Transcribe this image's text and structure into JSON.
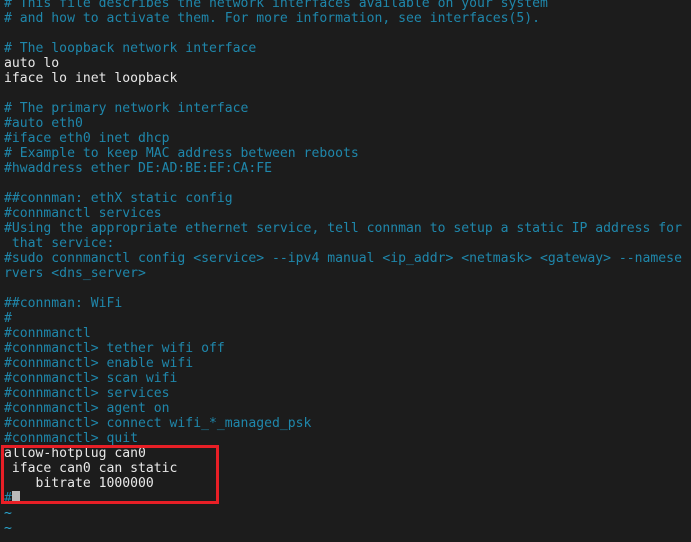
{
  "editor": {
    "background_color": "#1c1c1c",
    "comment_color": "#1f87ab",
    "text_color": "#e8e8e8",
    "tilde_color": "#2aa9d4",
    "annotation_color": "#e81f26",
    "cursor_color": "#b9b9b9"
  },
  "lines": [
    {
      "kind": "comment",
      "text": "# This file describes the network interfaces available on your system"
    },
    {
      "kind": "comment",
      "text": "# and how to activate them. For more information, see interfaces(5)."
    },
    {
      "kind": "blank",
      "text": ""
    },
    {
      "kind": "comment",
      "text": "# The loopback network interface"
    },
    {
      "kind": "plain",
      "text": "auto lo"
    },
    {
      "kind": "plain",
      "text": "iface lo inet loopback"
    },
    {
      "kind": "blank",
      "text": ""
    },
    {
      "kind": "comment",
      "text": "# The primary network interface"
    },
    {
      "kind": "comment",
      "text": "#auto eth0"
    },
    {
      "kind": "comment",
      "text": "#iface eth0 inet dhcp"
    },
    {
      "kind": "comment",
      "text": "# Example to keep MAC address between reboots"
    },
    {
      "kind": "comment",
      "text": "#hwaddress ether DE:AD:BE:EF:CA:FE"
    },
    {
      "kind": "blank",
      "text": ""
    },
    {
      "kind": "comment",
      "text": "##connman: ethX static config"
    },
    {
      "kind": "comment",
      "text": "#connmanctl services"
    },
    {
      "kind": "comment",
      "text": "#Using the appropriate ethernet service, tell connman to setup a static IP address for"
    },
    {
      "kind": "comment",
      "text": " that service:"
    },
    {
      "kind": "comment",
      "text": "#sudo connmanctl config <service> --ipv4 manual <ip_addr> <netmask> <gateway> --namese"
    },
    {
      "kind": "comment",
      "text": "rvers <dns_server>"
    },
    {
      "kind": "blank",
      "text": ""
    },
    {
      "kind": "comment",
      "text": "##connman: WiFi"
    },
    {
      "kind": "comment",
      "text": "#"
    },
    {
      "kind": "comment",
      "text": "#connmanctl"
    },
    {
      "kind": "comment",
      "text": "#connmanctl> tether wifi off"
    },
    {
      "kind": "comment",
      "text": "#connmanctl> enable wifi"
    },
    {
      "kind": "comment",
      "text": "#connmanctl> scan wifi"
    },
    {
      "kind": "comment",
      "text": "#connmanctl> services"
    },
    {
      "kind": "comment",
      "text": "#connmanctl> agent on"
    },
    {
      "kind": "comment",
      "text": "#connmanctl> connect wifi_*_managed_psk"
    },
    {
      "kind": "comment",
      "text": "#connmanctl> quit"
    },
    {
      "kind": "plain",
      "text": "allow-hotplug can0"
    },
    {
      "kind": "plain",
      "text": " iface can0 can static"
    },
    {
      "kind": "plain",
      "text": "    bitrate 1000000"
    },
    {
      "kind": "cursor",
      "text": "#"
    },
    {
      "kind": "tilde",
      "text": "~"
    },
    {
      "kind": "tilde",
      "text": "~"
    }
  ],
  "annotation": {
    "label": "can0-config-highlight"
  }
}
